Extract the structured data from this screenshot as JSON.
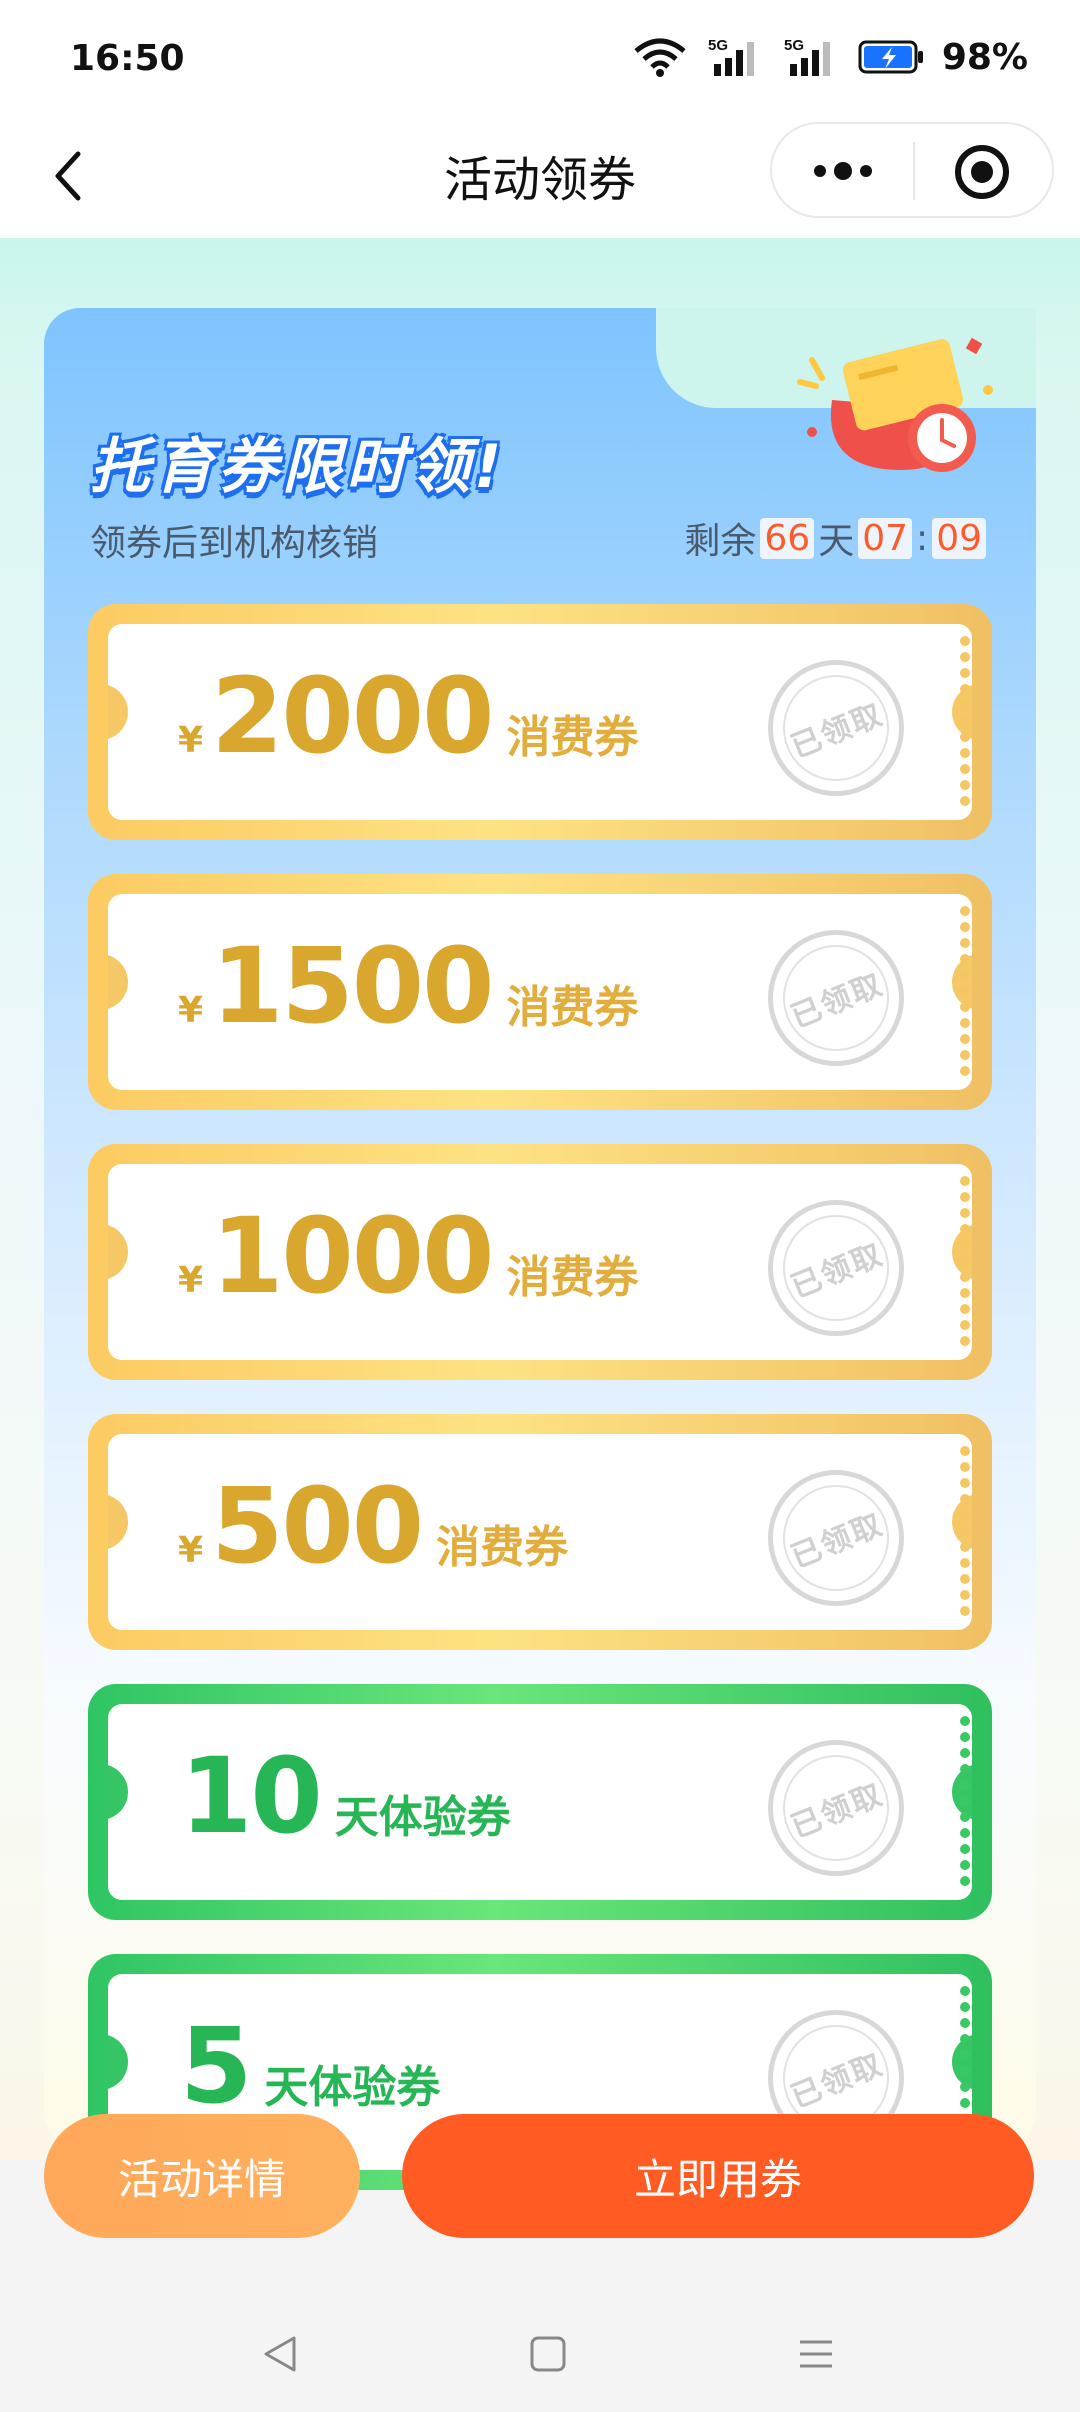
{
  "status_bar": {
    "time": "16:50",
    "battery_percent": "98%",
    "network_1": "5G",
    "network_2": "5G"
  },
  "nav": {
    "title": "活动领券",
    "back_icon": "chevron-left-icon",
    "more_icon": "more-dots-icon",
    "close_icon": "target-close-icon"
  },
  "card": {
    "title": "托育券限时领!",
    "subtitle": "领券后到机构核销",
    "countdown": {
      "prefix": "剩余",
      "days": "66",
      "days_unit": "天",
      "hours": "07",
      "sep": ":",
      "minutes": "09"
    }
  },
  "coupons": [
    {
      "currency": "¥",
      "amount": "2000",
      "kind": "消费券",
      "stamp": "已领取",
      "style": "gold"
    },
    {
      "currency": "¥",
      "amount": "1500",
      "kind": "消费券",
      "stamp": "已领取",
      "style": "gold"
    },
    {
      "currency": "¥",
      "amount": "1000",
      "kind": "消费券",
      "stamp": "已领取",
      "style": "gold"
    },
    {
      "currency": "¥",
      "amount": "500",
      "kind": "消费券",
      "stamp": "已领取",
      "style": "gold"
    },
    {
      "currency": "",
      "amount": "10",
      "kind": "天体验券",
      "stamp": "已领取",
      "style": "green"
    },
    {
      "currency": "",
      "amount": "5",
      "kind": "天体验券",
      "stamp": "已领取",
      "style": "green"
    }
  ],
  "buttons": {
    "detail": "活动详情",
    "use": "立即用券"
  },
  "colors": {
    "accent_orange": "#ff5b22",
    "detail_orange": "#ffa75a",
    "gold_text": "#d9a62e",
    "green_text": "#27b656",
    "title_blue": "#1e6ff0"
  }
}
